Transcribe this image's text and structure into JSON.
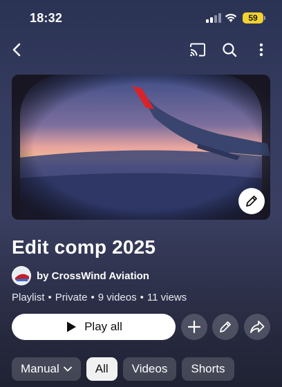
{
  "status": {
    "time": "18:32",
    "battery": "59"
  },
  "nav": {
    "back_icon": "chevron-left-icon",
    "cast_icon": "cast-icon",
    "search_icon": "search-icon",
    "more_icon": "more-vert-icon"
  },
  "playlist": {
    "title": "Edit comp 2025",
    "channel": "by CrossWind Aviation",
    "type": "Playlist",
    "privacy": "Private",
    "videos": "9 videos",
    "views": "11 views",
    "separator": "•"
  },
  "actions": {
    "play_all": "Play all",
    "play_icon": "play-icon",
    "add_icon": "plus-icon",
    "edit_icon": "pencil-icon",
    "share_icon": "share-icon"
  },
  "filters": {
    "sort_label": "Manual",
    "chips": [
      "All",
      "Videos",
      "Shorts"
    ],
    "selected": "All"
  },
  "colors": {
    "battery": "#f2d22e",
    "wing_tip": "#d8232a"
  }
}
